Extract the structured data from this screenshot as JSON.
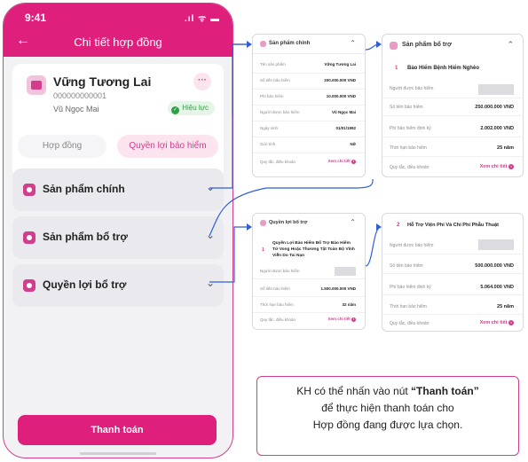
{
  "status_bar": {
    "time": "9:41",
    "icons": ".ıl ᯤ ▬"
  },
  "header": {
    "title": "Chi tiết hợp đồng"
  },
  "contract": {
    "name": "Vững Tương Lai",
    "number": "000000000001",
    "holder": "Vũ Ngọc Mai",
    "status": "Hiệu lực",
    "more": "···"
  },
  "tabs": [
    {
      "label": "Hợp đồng",
      "active": false
    },
    {
      "label": "Quyền lợi bảo hiểm",
      "active": true
    }
  ],
  "accordions": [
    {
      "label": "Sản phẩm chính"
    },
    {
      "label": "Sản phẩm bổ trợ"
    },
    {
      "label": "Quyền lợi bổ trợ"
    }
  ],
  "pay_button": "Thanh toán",
  "main_product_panel": {
    "title": "Sản phẩm chính",
    "rows": [
      {
        "k": "Tên sản phẩm",
        "v": "Vững Tương Lai"
      },
      {
        "k": "Số tiền bảo hiểm",
        "v": "200.000.000 VND"
      },
      {
        "k": "Phí bảo hiểm",
        "v": "10.000.000 VND"
      },
      {
        "k": "Người được bảo hiểm",
        "v": "Vũ Ngọc Mai"
      },
      {
        "k": "Ngày sinh",
        "v": "01/01/1992"
      },
      {
        "k": "Giới tính",
        "v": "Nữ"
      }
    ],
    "rules_label": "Quy tắc, điều khoản",
    "rules_link": "Xem chi tiết"
  },
  "supplementary_panel": {
    "title": "Sản phẩm bổ trợ",
    "index": "1",
    "name": "Bảo Hiểm Bệnh Hiểm Nghèo",
    "rows": [
      {
        "k": "Người được bảo hiểm",
        "v": ""
      },
      {
        "k": "Số tiền bảo hiểm",
        "v": "250.000.000 VND"
      },
      {
        "k": "Phí bảo hiểm định kỳ",
        "v": "2.002.000 VND"
      },
      {
        "k": "Thời hạn bảo hiểm",
        "v": "25 năm"
      }
    ],
    "rules_label": "Quy tắc, điều khoản",
    "rules_link": "Xem chi tiết"
  },
  "rider_panel": {
    "title": "Quyền lợi bổ trợ",
    "index": "1",
    "name_lines": [
      "Quyền Lợi Bảo Hiểm Bổ Trợ Bảo Hiểm",
      "Tử Vong Hoặc Thương Tật Toàn Bộ Vĩnh",
      "Viễn Do Tai Nạn"
    ],
    "rows": [
      {
        "k": "Người được bảo hiểm",
        "v": ""
      },
      {
        "k": "Số tiền bảo hiểm",
        "v": "1.500.000.000 VND"
      },
      {
        "k": "Thời hạn bảo hiểm",
        "v": "32 năm"
      }
    ],
    "rules_label": "Quy tắc, điều khoản",
    "rules_link": "Xem chi tiết"
  },
  "hospital_panel": {
    "index": "2",
    "name": "Hỗ Trợ Viện Phí Và Chi Phí Phẫu Thuật",
    "rows": [
      {
        "k": "Người được bảo hiểm",
        "v": ""
      },
      {
        "k": "Số tiền bảo hiểm",
        "v": "500.000.000 VND"
      },
      {
        "k": "Phí bảo hiểm định kỳ",
        "v": "5.064.000 VND"
      },
      {
        "k": "Thời hạn bảo hiểm",
        "v": "25 năm"
      }
    ],
    "rules_label": "Quy tắc, điều khoản",
    "rules_link": "Xem chi tiết"
  },
  "note": {
    "line1_prefix": "KH có thể nhấn vào nút ",
    "line1_bold": "“Thanh toán”",
    "line2": "để thực hiện thanh toán cho",
    "line3": "Hợp đồng đang được lựa chọn."
  },
  "colors": {
    "brand": "#df1f7c",
    "accent": "#d23d8c",
    "success": "#2ea043"
  }
}
